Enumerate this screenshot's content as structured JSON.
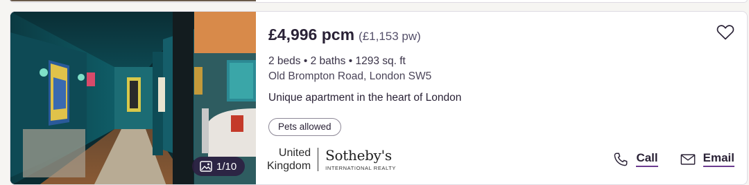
{
  "listing": {
    "price": "£4,996 pcm",
    "price_per_week": "(£1,153 pw)",
    "specs": "2 beds • 2 baths • 1293 sq. ft",
    "address": "Old Brompton Road, London SW5",
    "headline": "Unique apartment in the heart of London",
    "tags": [
      "Pets allowed"
    ],
    "photo_counter": "1/10"
  },
  "agent": {
    "region_line1": "United",
    "region_line2": "Kingdom",
    "brand_name": "Sotheby's",
    "brand_sub": "INTERNATIONAL REALTY"
  },
  "actions": {
    "call_label": "Call",
    "email_label": "Email"
  },
  "icons": {
    "favourite": "heart-outline-icon",
    "photos": "image-icon",
    "call": "phone-icon",
    "email": "envelope-icon"
  },
  "colors": {
    "text_primary": "#2a2236",
    "accent_underline": "#6b3a8f",
    "badge_bg": "#2c1e40"
  }
}
